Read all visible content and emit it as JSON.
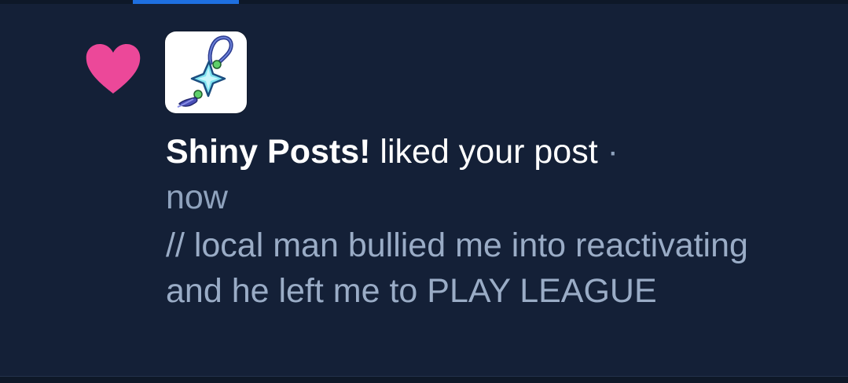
{
  "tab": {
    "active_index": 0
  },
  "notification": {
    "type_icon": "heart-icon",
    "heart_color": "#ec4899",
    "avatar_icon": "shiny-charm-icon",
    "actor": "Shiny Posts!",
    "action": "liked your post",
    "separator": "·",
    "time": "now",
    "post_snippet": "// local man bullied me into reactivating and he left me to PLAY LEAGUE"
  },
  "colors": {
    "background": "#142037",
    "accent": "#1e6fe0",
    "secondary_text": "#9aacc6"
  }
}
